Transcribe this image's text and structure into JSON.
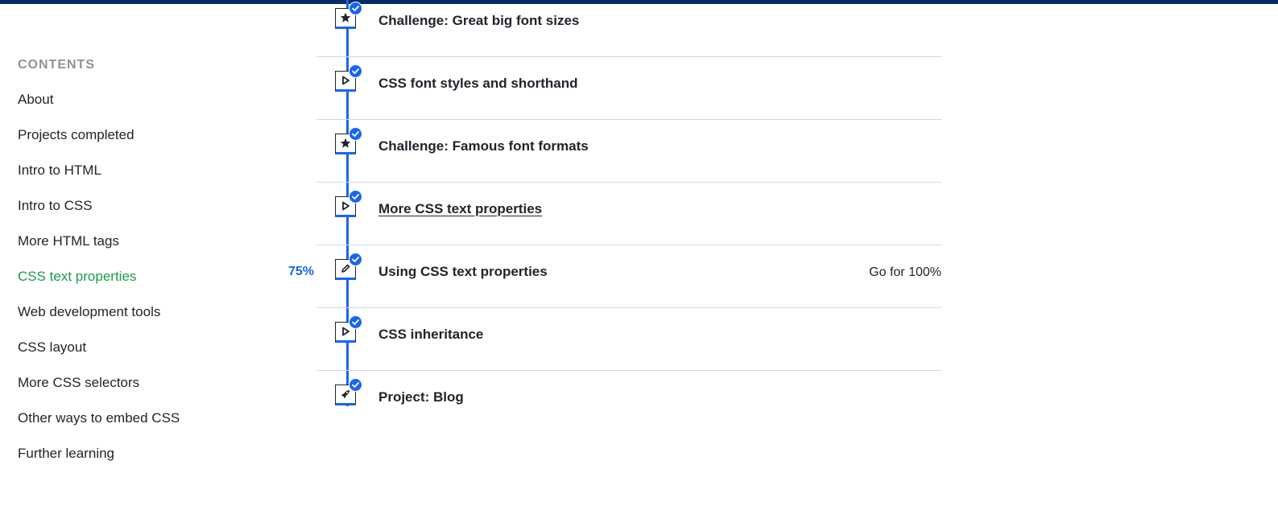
{
  "sidebar": {
    "heading": "CONTENTS",
    "items": [
      {
        "label": "About"
      },
      {
        "label": "Projects completed"
      },
      {
        "label": "Intro to HTML"
      },
      {
        "label": "Intro to CSS"
      },
      {
        "label": "More HTML tags"
      },
      {
        "label": "CSS text properties",
        "active": true
      },
      {
        "label": "Web development tools"
      },
      {
        "label": "CSS layout"
      },
      {
        "label": "More CSS selectors"
      },
      {
        "label": "Other ways to embed CSS"
      },
      {
        "label": "Further learning"
      }
    ]
  },
  "colors": {
    "accent": "#1865f2",
    "active": "#1c9b4b",
    "top_bar": "#0a2a66"
  },
  "lessons": [
    {
      "icon": "star-icon",
      "title": "Challenge: Great big font sizes",
      "completed": true
    },
    {
      "icon": "play-icon",
      "title": "CSS font styles and shorthand",
      "completed": true
    },
    {
      "icon": "star-icon",
      "title": "Challenge: Famous font formats",
      "completed": true
    },
    {
      "icon": "play-icon",
      "title": "More CSS text properties",
      "completed": true
    },
    {
      "icon": "pencil-icon",
      "title": "Using CSS text properties",
      "completed": true,
      "progress": "75%",
      "action": "Go for 100%"
    },
    {
      "icon": "play-icon",
      "title": "CSS inheritance",
      "completed": true
    },
    {
      "icon": "rocket-icon",
      "title": "Project: Blog",
      "completed": true
    }
  ]
}
